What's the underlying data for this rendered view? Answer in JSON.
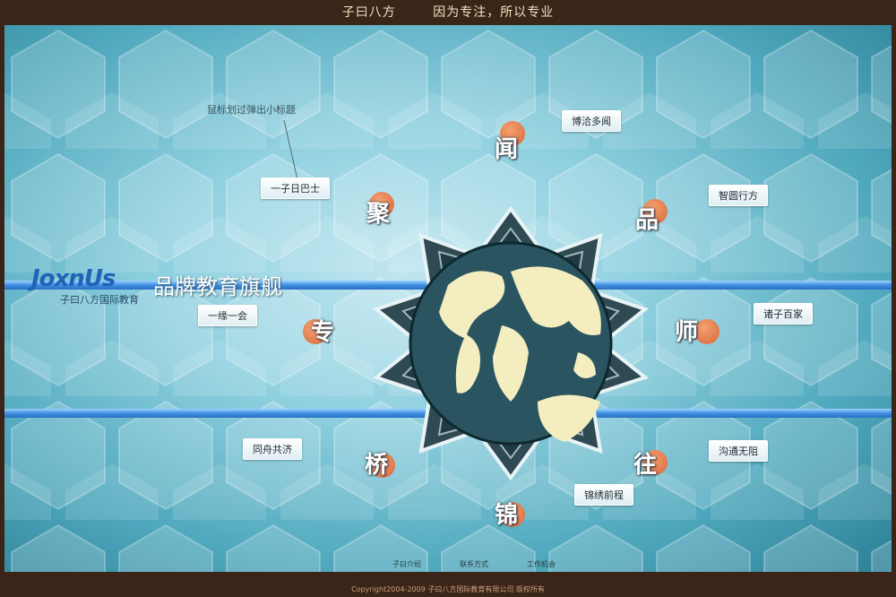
{
  "top_bar": {
    "site_name": "子曰八方",
    "slogan": "因为专注，所以专业"
  },
  "brand": {
    "logo_text": "JoxnUs",
    "logo_sub": "子曰八方国际教育",
    "title": "品牌教育旗舰"
  },
  "hint": "鼠标划过弹出小标题",
  "nodes": [
    {
      "char": "闻",
      "tag": "博洽多闻"
    },
    {
      "char": "品",
      "tag": "智圆行方"
    },
    {
      "char": "师",
      "tag": "诸子百家"
    },
    {
      "char": "往",
      "tag": "沟通无阻"
    },
    {
      "char": "锦",
      "tag": "锦绣前程"
    },
    {
      "char": "桥",
      "tag": "同舟共济"
    },
    {
      "char": "专",
      "tag": "一缘一会"
    },
    {
      "char": "聚",
      "tag": "一子日巴士"
    }
  ],
  "footer_links": [
    "子曰介绍",
    "联系方式",
    "工作机会"
  ],
  "copyright": "Copyright2004-2009  子曰八方国际教育有限公司  版权所有",
  "colors": {
    "frame": "#3b2418",
    "accent_orange": "#e07a45",
    "band_blue": "#3f8fe0"
  }
}
